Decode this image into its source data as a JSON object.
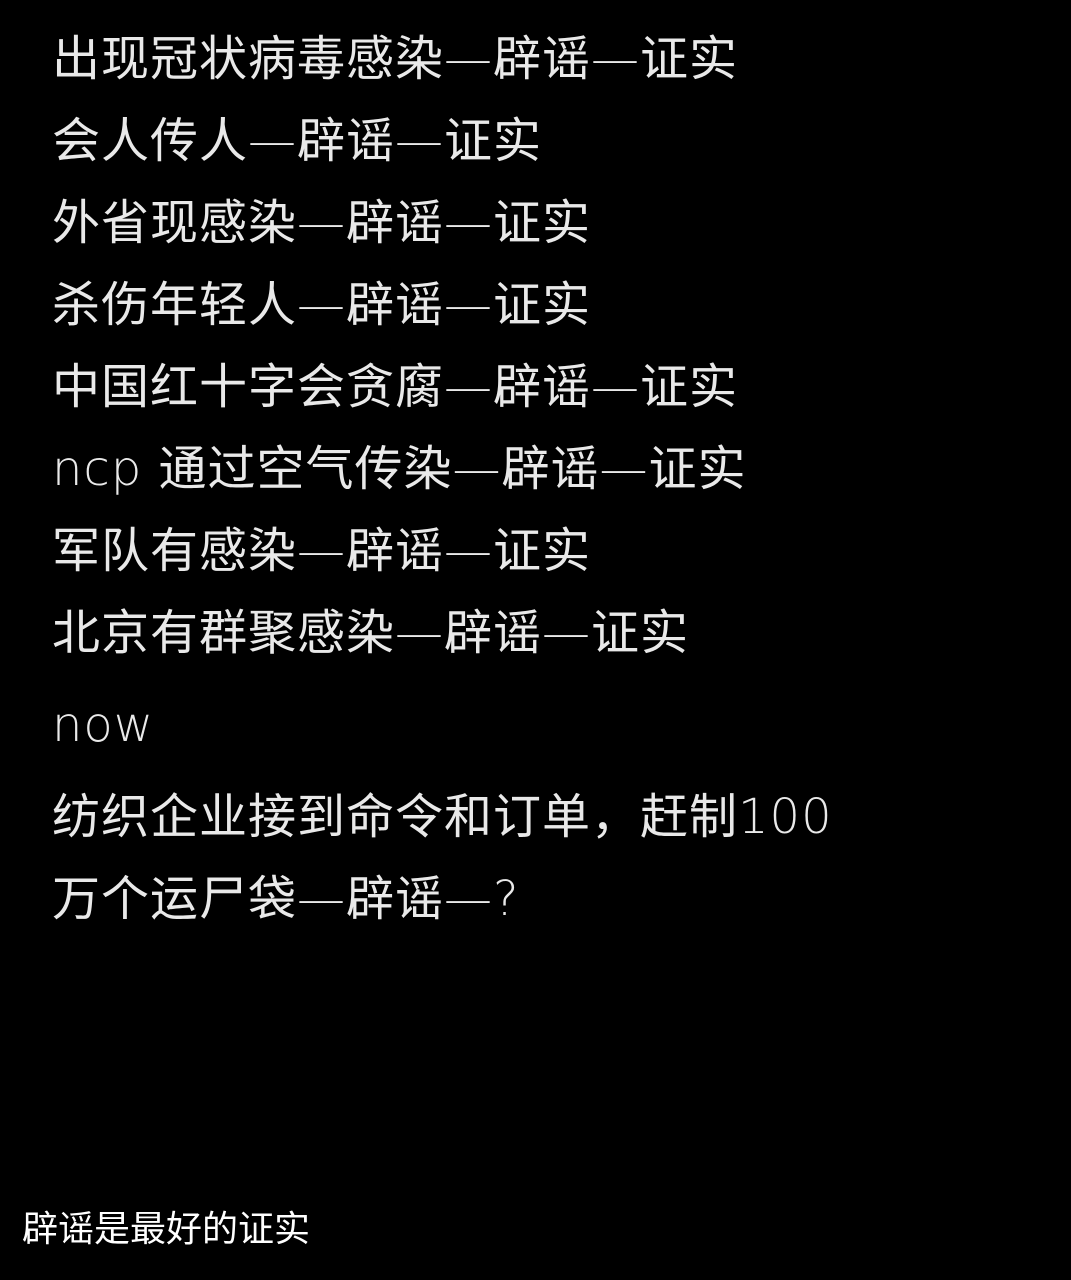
{
  "note": {
    "lines": [
      "出现冠状病毒感染—辟谣—证实",
      "会人传人—辟谣—证实",
      "外省现感染—辟谣—证实",
      "杀伤年轻人—辟谣—证实",
      "中国红十字会贪腐—辟谣—证实",
      "ncp 通过空气传染—辟谣—证实",
      "军队有感染—辟谣—证实",
      "北京有群聚感染—辟谣—证实"
    ],
    "now_label": "now",
    "final_lines": [
      "纺织企业接到命令和订单，赶制100",
      "万个运尸袋—辟谣—?"
    ]
  },
  "caption": "辟谣是最好的证实",
  "colors": {
    "background": "#000000",
    "note_text": "#e9e9e9",
    "caption_text": "#ffffff"
  }
}
